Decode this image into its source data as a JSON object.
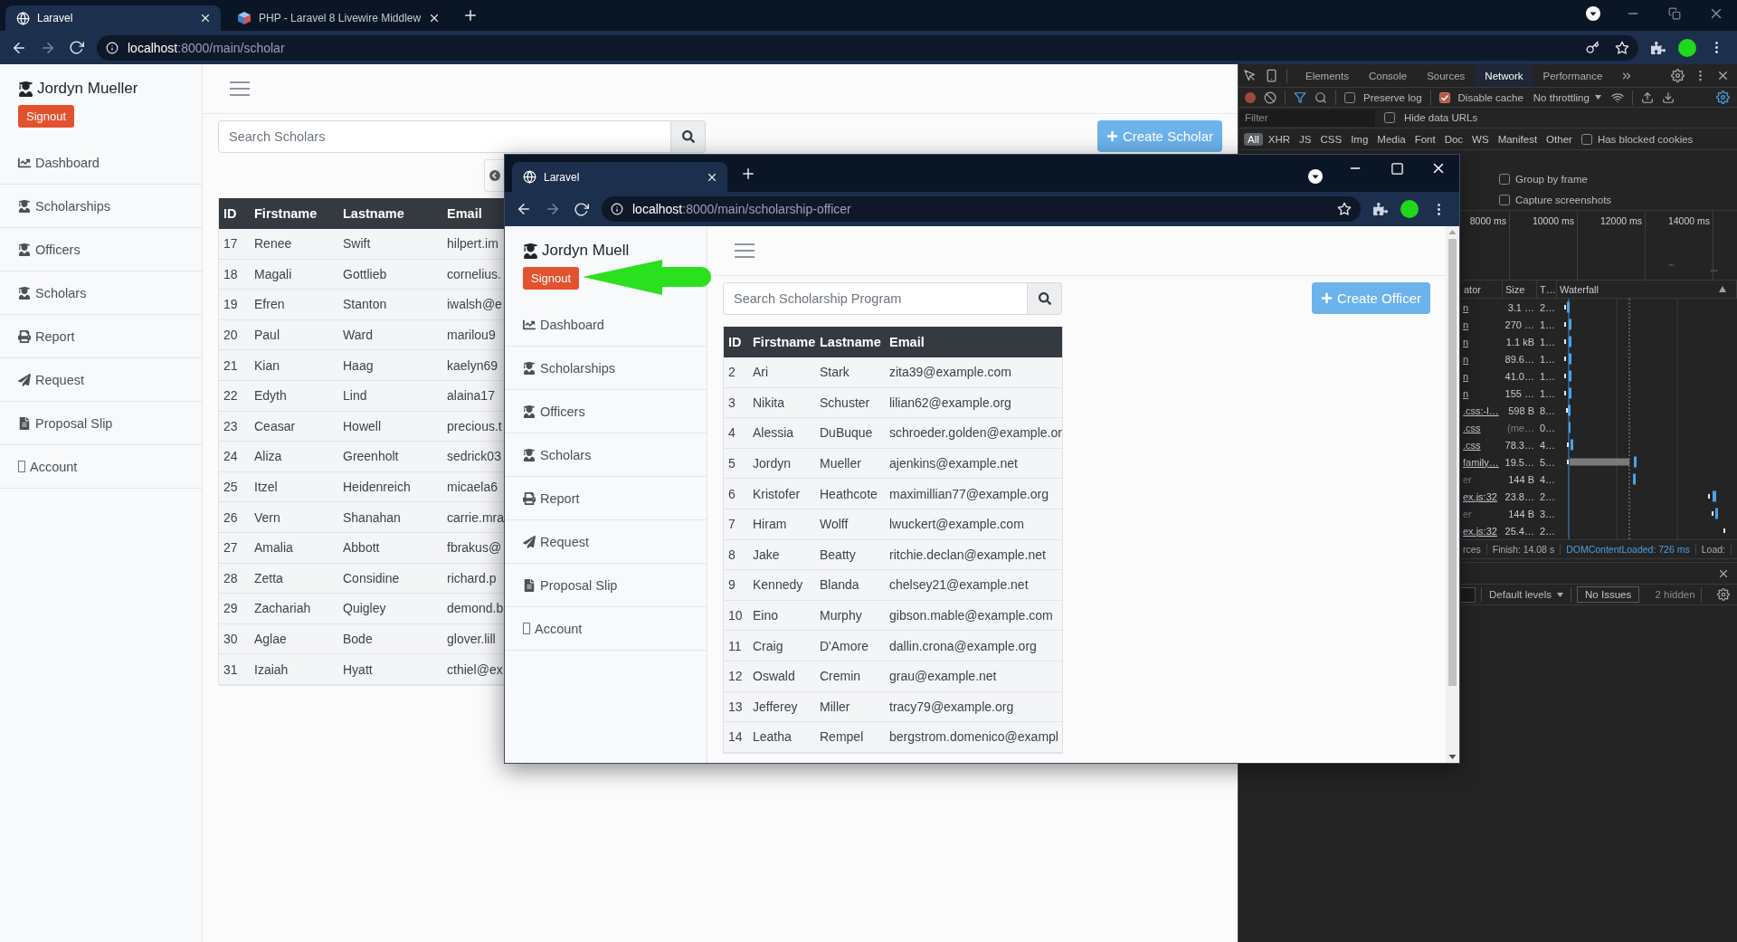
{
  "browser": {
    "tabs": [
      {
        "title": "Laravel",
        "selected": true
      },
      {
        "title": "PHP - Laravel 8 Livewire Middlew",
        "selected": false
      }
    ],
    "url": {
      "host": "localhost",
      "path": ":8000/main/scholar"
    }
  },
  "page": {
    "sidebar": {
      "user_name": "Jordyn Mueller",
      "signout": "Signout",
      "items": [
        {
          "label": "Dashboard",
          "kind": "chart"
        },
        {
          "label": "Scholarships",
          "kind": "graduate"
        },
        {
          "label": "Officers",
          "kind": "graduate"
        },
        {
          "label": "Scholars",
          "kind": "graduate"
        },
        {
          "label": "Report",
          "kind": "printer"
        },
        {
          "label": "Request",
          "kind": "send"
        },
        {
          "label": "Proposal Slip",
          "kind": "document"
        },
        {
          "label": "Account",
          "kind": "missing"
        }
      ]
    },
    "search": {
      "placeholder": "Search Scholars"
    },
    "create_button": "Create Scholar",
    "table": {
      "columns": [
        "ID",
        "Firstname",
        "Lastname",
        "Email"
      ],
      "rows": [
        [
          "17",
          "Renee",
          "Swift",
          "hilpert.im"
        ],
        [
          "18",
          "Magali",
          "Gottlieb",
          "cornelius."
        ],
        [
          "19",
          "Efren",
          "Stanton",
          "iwalsh@e"
        ],
        [
          "20",
          "Paul",
          "Ward",
          "marilou9"
        ],
        [
          "21",
          "Kian",
          "Haag",
          "kaelyn69"
        ],
        [
          "22",
          "Edyth",
          "Lind",
          "alaina17"
        ],
        [
          "23",
          "Ceasar",
          "Howell",
          "precious.t"
        ],
        [
          "24",
          "Aliza",
          "Greenholt",
          "sedrick03"
        ],
        [
          "25",
          "Itzel",
          "Heidenreich",
          "micaela6"
        ],
        [
          "26",
          "Vern",
          "Shanahan",
          "carrie.mra"
        ],
        [
          "27",
          "Amalia",
          "Abbott",
          "fbrakus@"
        ],
        [
          "28",
          "Zetta",
          "Considine",
          "richard.p"
        ],
        [
          "29",
          "Zachariah",
          "Quigley",
          "demond.b"
        ],
        [
          "30",
          "Aglae",
          "Bode",
          "glover.lill"
        ],
        [
          "31",
          "Izaiah",
          "Hyatt",
          "cthiel@ex"
        ]
      ]
    }
  },
  "devtools": {
    "tabs": [
      {
        "label": "Elements",
        "selected": false
      },
      {
        "label": "Console",
        "selected": false
      },
      {
        "label": "Sources",
        "selected": false
      },
      {
        "label": "Network",
        "selected": true
      },
      {
        "label": "Performance",
        "selected": false
      }
    ],
    "preserve_log": {
      "label": "Preserve log",
      "checked": false
    },
    "disable_cache": {
      "label": "Disable cache",
      "checked": true
    },
    "throttling": "No throttling",
    "filter": {
      "placeholder": "Filter"
    },
    "hide_data_urls": {
      "label": "Hide data URLs",
      "checked": false
    },
    "type_filters": [
      {
        "label": "All",
        "selected": true
      },
      {
        "label": "XHR",
        "selected": false
      },
      {
        "label": "JS",
        "selected": false
      },
      {
        "label": "CSS",
        "selected": false
      },
      {
        "label": "Img",
        "selected": false
      },
      {
        "label": "Media",
        "selected": false
      },
      {
        "label": "Font",
        "selected": false
      },
      {
        "label": "Doc",
        "selected": false
      },
      {
        "label": "WS",
        "selected": false
      },
      {
        "label": "Manifest",
        "selected": false
      },
      {
        "label": "Other",
        "selected": false
      }
    ],
    "blocked_cookies": {
      "label": "Has blocked cookies",
      "checked": false
    },
    "settings": [
      {
        "label": "Group by frame",
        "checked": false
      },
      {
        "label": "Capture screenshots",
        "checked": false
      }
    ],
    "overview_ticks": [
      "8000 ms",
      "10000 ms",
      "12000 ms",
      "14000 ms"
    ],
    "requests": {
      "columns": [
        "ator",
        "Size",
        "T…",
        "Waterfall"
      ],
      "rows": [
        {
          "initiator": "n",
          "link": true,
          "size": "3.1 …",
          "size_dimmed": false,
          "time": "2…"
        },
        {
          "initiator": "n",
          "link": true,
          "size": "270 …",
          "size_dimmed": false,
          "time": "1…"
        },
        {
          "initiator": "n",
          "link": true,
          "size": "1.1 kB",
          "size_dimmed": false,
          "time": "1…"
        },
        {
          "initiator": "n",
          "link": true,
          "size": "89.6…",
          "size_dimmed": false,
          "time": "1…"
        },
        {
          "initiator": "n",
          "link": true,
          "size": "41.0…",
          "size_dimmed": false,
          "time": "1…"
        },
        {
          "initiator": "n",
          "link": true,
          "size": "155 …",
          "size_dimmed": false,
          "time": "1…"
        },
        {
          "initiator": ".css:-l…",
          "link": true,
          "size": "598 B",
          "size_dimmed": false,
          "time": "8…"
        },
        {
          "initiator": ".css",
          "link": true,
          "size": "(me…",
          "size_dimmed": true,
          "time": "0…"
        },
        {
          "initiator": ".css",
          "link": true,
          "size": "78.3…",
          "size_dimmed": false,
          "time": "4…"
        },
        {
          "initiator": "family…",
          "link": true,
          "size": "19.5…",
          "size_dimmed": false,
          "time": "5…"
        },
        {
          "initiator": "er",
          "link": false,
          "size": "144 B",
          "size_dimmed": false,
          "time": "4…"
        },
        {
          "initiator": "ex.js:32",
          "link": true,
          "size": "23.8…",
          "size_dimmed": false,
          "time": "2…"
        },
        {
          "initiator": "er",
          "link": false,
          "size": "144 B",
          "size_dimmed": false,
          "time": "3…"
        },
        {
          "initiator": "ex.js:32",
          "link": true,
          "size": "25.4…",
          "size_dimmed": false,
          "time": "2…"
        }
      ]
    },
    "summary": [
      {
        "text": "rces",
        "kind": "plain"
      },
      {
        "text": "Finish: 14.08 s",
        "kind": "plain"
      },
      {
        "text": "DOMContentLoaded: 726 ms",
        "kind": "event"
      },
      {
        "text": "Load:",
        "kind": "plain"
      }
    ],
    "console": {
      "levels": "Default levels",
      "issues": "No Issues",
      "hidden": "2 hidden"
    }
  },
  "popup_window": {
    "tabs": [
      {
        "title": "Laravel",
        "selected": true
      }
    ],
    "url": {
      "host": "localhost",
      "path": ":8000/main/scholarship-officer"
    },
    "page": {
      "sidebar": {
        "user_name": "Jordyn Muell",
        "signout": "Signout",
        "items": [
          {
            "label": "Dashboard",
            "kind": "chart"
          },
          {
            "label": "Scholarships",
            "kind": "graduate"
          },
          {
            "label": "Officers",
            "kind": "graduate"
          },
          {
            "label": "Scholars",
            "kind": "graduate"
          },
          {
            "label": "Report",
            "kind": "printer"
          },
          {
            "label": "Request",
            "kind": "send"
          },
          {
            "label": "Proposal Slip",
            "kind": "document"
          },
          {
            "label": "Account",
            "kind": "missing"
          }
        ]
      },
      "search": {
        "placeholder": "Search Scholarship Program"
      },
      "create_button": "Create Officer",
      "table": {
        "columns": [
          "ID",
          "Firstname",
          "Lastname",
          "Email"
        ],
        "rows": [
          [
            "2",
            "Ari",
            "Stark",
            "zita39@example.com"
          ],
          [
            "3",
            "Nikita",
            "Schuster",
            "lilian62@example.org"
          ],
          [
            "4",
            "Alessia",
            "DuBuque",
            "schroeder.golden@example.or"
          ],
          [
            "5",
            "Jordyn",
            "Mueller",
            "ajenkins@example.net"
          ],
          [
            "6",
            "Kristofer",
            "Heathcote",
            "maximillian77@example.org"
          ],
          [
            "7",
            "Hiram",
            "Wolff",
            "lwuckert@example.com"
          ],
          [
            "8",
            "Jake",
            "Beatty",
            "ritchie.declan@example.net"
          ],
          [
            "9",
            "Kennedy",
            "Blanda",
            "chelsey21@example.net"
          ],
          [
            "10",
            "Eino",
            "Murphy",
            "gibson.mable@example.com"
          ],
          [
            "11",
            "Craig",
            "D'Amore",
            "dallin.crona@example.org"
          ],
          [
            "12",
            "Oswald",
            "Cremin",
            "grau@example.net"
          ],
          [
            "13",
            "Jefferey",
            "Miller",
            "tracy79@example.org"
          ],
          [
            "14",
            "Leatha",
            "Rempel",
            "bergstrom.domenico@exampl"
          ]
        ]
      }
    }
  }
}
